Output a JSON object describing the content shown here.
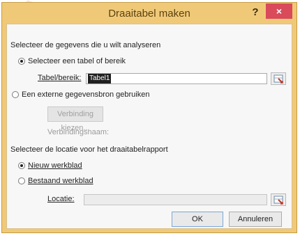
{
  "window": {
    "title": "Draaitabel maken",
    "help_glyph": "?",
    "close_glyph": "×"
  },
  "section1": {
    "heading": "Selecteer de gegevens die u wilt analyseren",
    "option_table": "Selecteer een tabel of bereik",
    "table_range_label": "Tabel/bereik:",
    "table_range_value": "Tabel1",
    "option_external": "Een externe gegevensbron gebruiken",
    "choose_connection": "Verbinding kiezen...",
    "connection_name": "Verbindingsnaam:"
  },
  "section2": {
    "heading": "Selecteer de locatie voor het draaitabelrapport",
    "option_new": "Nieuw werkblad",
    "option_existing": "Bestaand werkblad",
    "location_label": "Locatie:",
    "location_value": ""
  },
  "buttons": {
    "ok": "OK",
    "cancel": "Annuleren"
  },
  "colors": {
    "frame": "#f0c978",
    "close": "#d94a5a"
  }
}
